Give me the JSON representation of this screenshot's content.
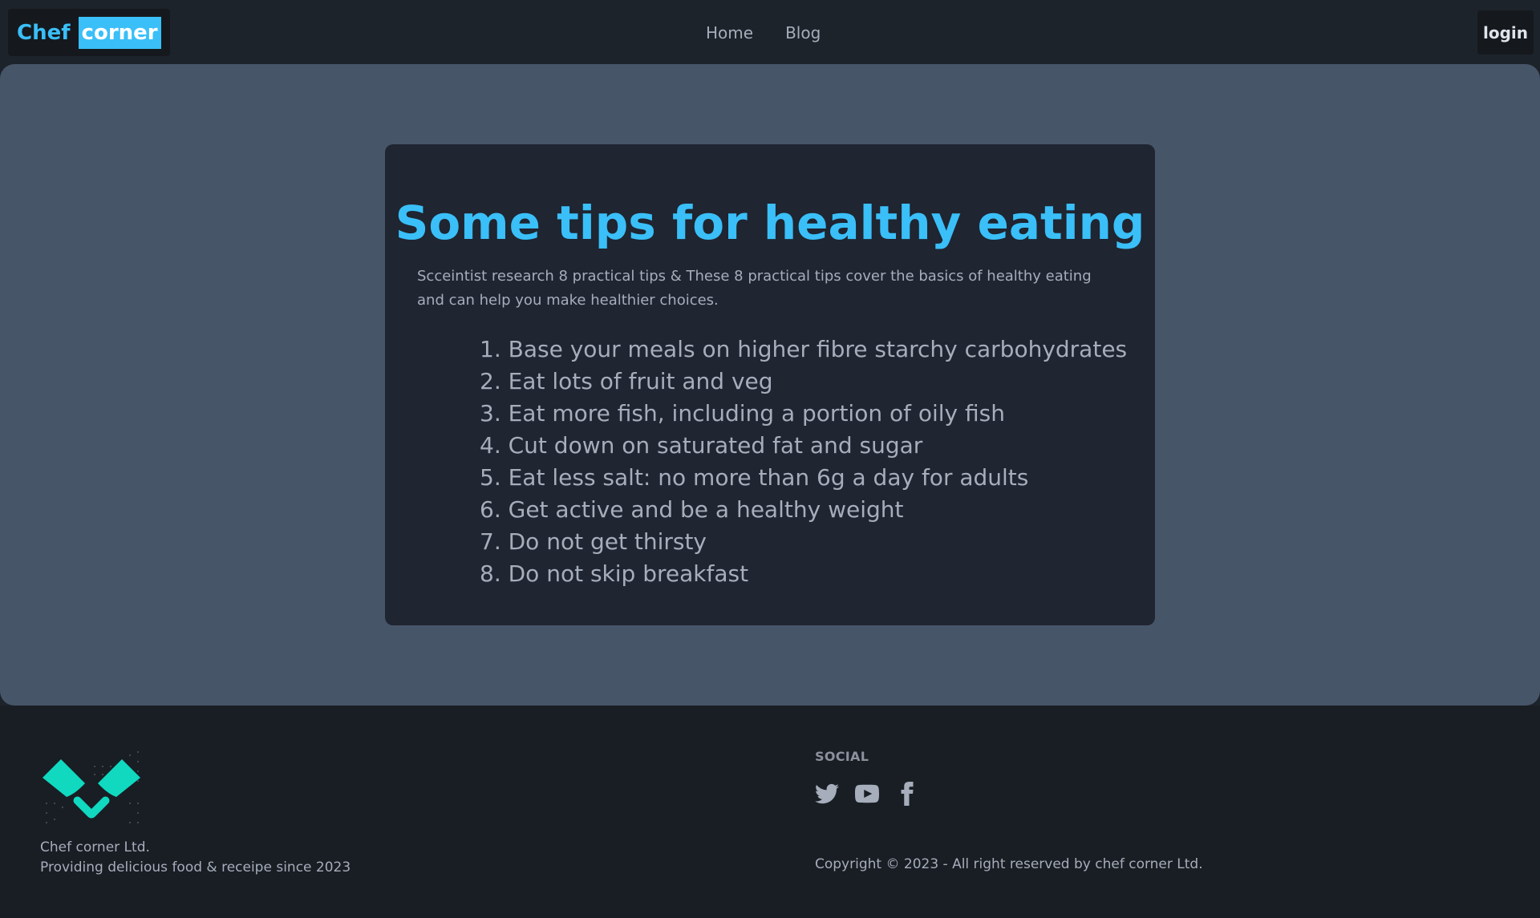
{
  "navbar": {
    "brand_part1": "Chef",
    "brand_part2": "corner",
    "links": [
      "Home",
      "Blog"
    ],
    "login_label": "login"
  },
  "article": {
    "title": "Some tips for healthy eating",
    "description": "Scceintist research 8 practical tips & These 8 practical tips cover the basics of healthy eating and can help you make healthier choices.",
    "tips": [
      "1. Base your meals on higher fibre starchy carbohydrates",
      "2. Eat lots of fruit and veg",
      "3. Eat more fish, including a portion of oily fish",
      "4. Cut down on saturated fat and sugar",
      "5. Eat less salt: no more than 6g a day for adults",
      "6. Get active and be a healthy weight",
      "7. Do not get thirsty",
      "8. Do not skip breakfast"
    ]
  },
  "footer": {
    "company_name": "Chef corner Ltd.",
    "tagline": "Providing delicious food & receipe since 2023",
    "social_title": "SOCIAL",
    "social_icons": [
      "twitter-icon",
      "youtube-icon",
      "facebook-icon"
    ],
    "copyright": "Copyright © 2023 - All right reserved by chef corner Ltd."
  },
  "colors": {
    "accent": "#3abff8",
    "logo": "#10d9c0",
    "hero_bg": "#475569",
    "card_bg": "#1f2531",
    "page_bg": "#1d232a"
  }
}
